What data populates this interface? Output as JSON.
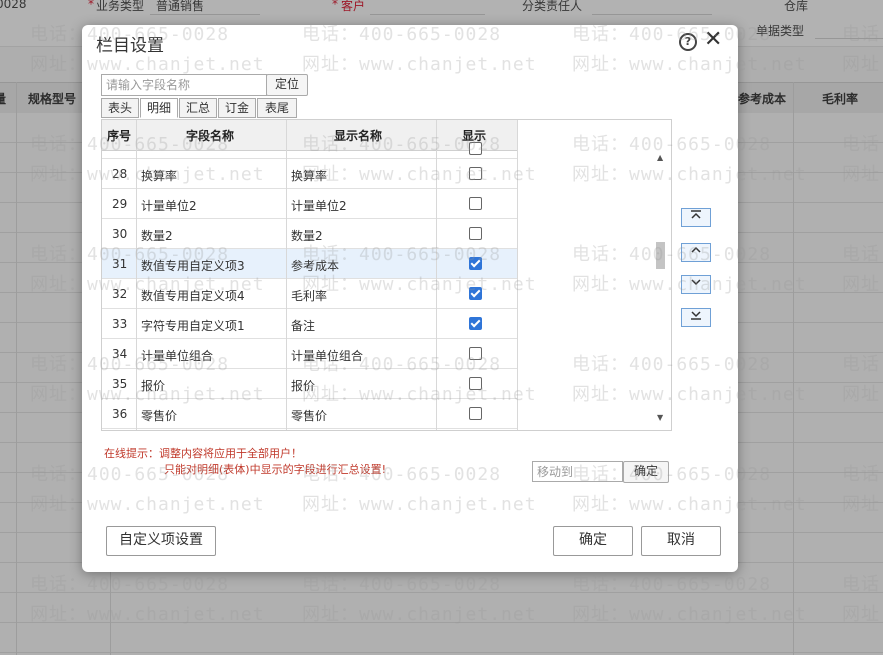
{
  "background": {
    "top_code": "0028",
    "field_business_type_label": "业务类型",
    "field_business_type_value": "普通销售",
    "field_customer_label": "客户",
    "field_dept_manager_label": "分类责任人",
    "field_warehouse_label": "仓库",
    "field_doc_type_label": "单据类型",
    "required_mark": "*",
    "grid_headers": [
      "量",
      "规格型号",
      "参考成本",
      "毛利率"
    ]
  },
  "watermark": {
    "phone": "电话：400-665-0028",
    "site": "网址：www.chanjet.net"
  },
  "dialog": {
    "title": "栏目设置",
    "help_glyph": "?",
    "close_glyph": "✕",
    "search_placeholder": "请输入字段名称",
    "locate_button": "定位",
    "tabs": [
      "表头",
      "明细",
      "汇总",
      "订金",
      "表尾"
    ],
    "active_tab": "明细",
    "table": {
      "headers": [
        "序号",
        "字段名称",
        "显示名称",
        "显示"
      ],
      "rows": [
        {
          "no": "28",
          "field": "换算率",
          "display": "换算率",
          "checked": false,
          "highlight": false
        },
        {
          "no": "29",
          "field": "计量单位2",
          "display": "计量单位2",
          "checked": false,
          "highlight": false
        },
        {
          "no": "30",
          "field": "数量2",
          "display": "数量2",
          "checked": false,
          "highlight": false
        },
        {
          "no": "31",
          "field": "数值专用自定义项3",
          "display": "参考成本",
          "checked": true,
          "highlight": true
        },
        {
          "no": "32",
          "field": "数值专用自定义项4",
          "display": "毛利率",
          "checked": true,
          "highlight": false
        },
        {
          "no": "33",
          "field": "字符专用自定义项1",
          "display": "备注",
          "checked": true,
          "highlight": false
        },
        {
          "no": "34",
          "field": "计量单位组合",
          "display": "计量单位组合",
          "checked": false,
          "highlight": false
        },
        {
          "no": "35",
          "field": "报价",
          "display": "报价",
          "checked": false,
          "highlight": false
        },
        {
          "no": "36",
          "field": "零售价",
          "display": "零售价",
          "checked": false,
          "highlight": false
        }
      ]
    },
    "move_buttons": {
      "top": "⌅",
      "up": "⌃",
      "down": "⌄",
      "bottom": "⌄"
    },
    "hint_line1": "在线提示：调整内容将应用于全部用户！",
    "hint_line2": "只能对明细(表体)中显示的字段进行汇总设置!",
    "move_to_placeholder": "移动到",
    "move_to_confirm": "确定",
    "custom_button": "自定义项设置",
    "ok_button": "确定",
    "cancel_button": "取消"
  },
  "colors": {
    "checkbox_on": "#2f75d8",
    "hint_text": "#c0392b",
    "row_highlight": "#e7f1fc"
  }
}
